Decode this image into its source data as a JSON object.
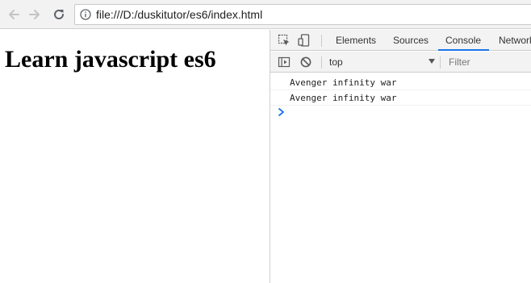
{
  "browser": {
    "url": "file:///D:/duskitutor/es6/index.html"
  },
  "page": {
    "heading": "Learn javascript es6"
  },
  "devtools": {
    "tabs": [
      {
        "label": "Elements"
      },
      {
        "label": "Sources"
      },
      {
        "label": "Console"
      },
      {
        "label": "Network"
      }
    ],
    "active_tab": "Console",
    "active_color": "#1a73e8",
    "console": {
      "context": "top",
      "filter_placeholder": "Filter",
      "messages": [
        {
          "text": "Avenger infinity war"
        },
        {
          "text": "Avenger infinity war"
        }
      ],
      "prompt_color": "#1a73e8"
    }
  },
  "icons": {
    "back": "arrow-left-icon",
    "forward": "arrow-right-icon",
    "reload": "reload-icon",
    "info": "info-icon",
    "inspect": "inspect-element-icon",
    "device": "device-toolbar-icon",
    "sidebar": "console-sidebar-icon",
    "clear": "clear-console-icon",
    "prompt": "console-prompt-icon"
  }
}
